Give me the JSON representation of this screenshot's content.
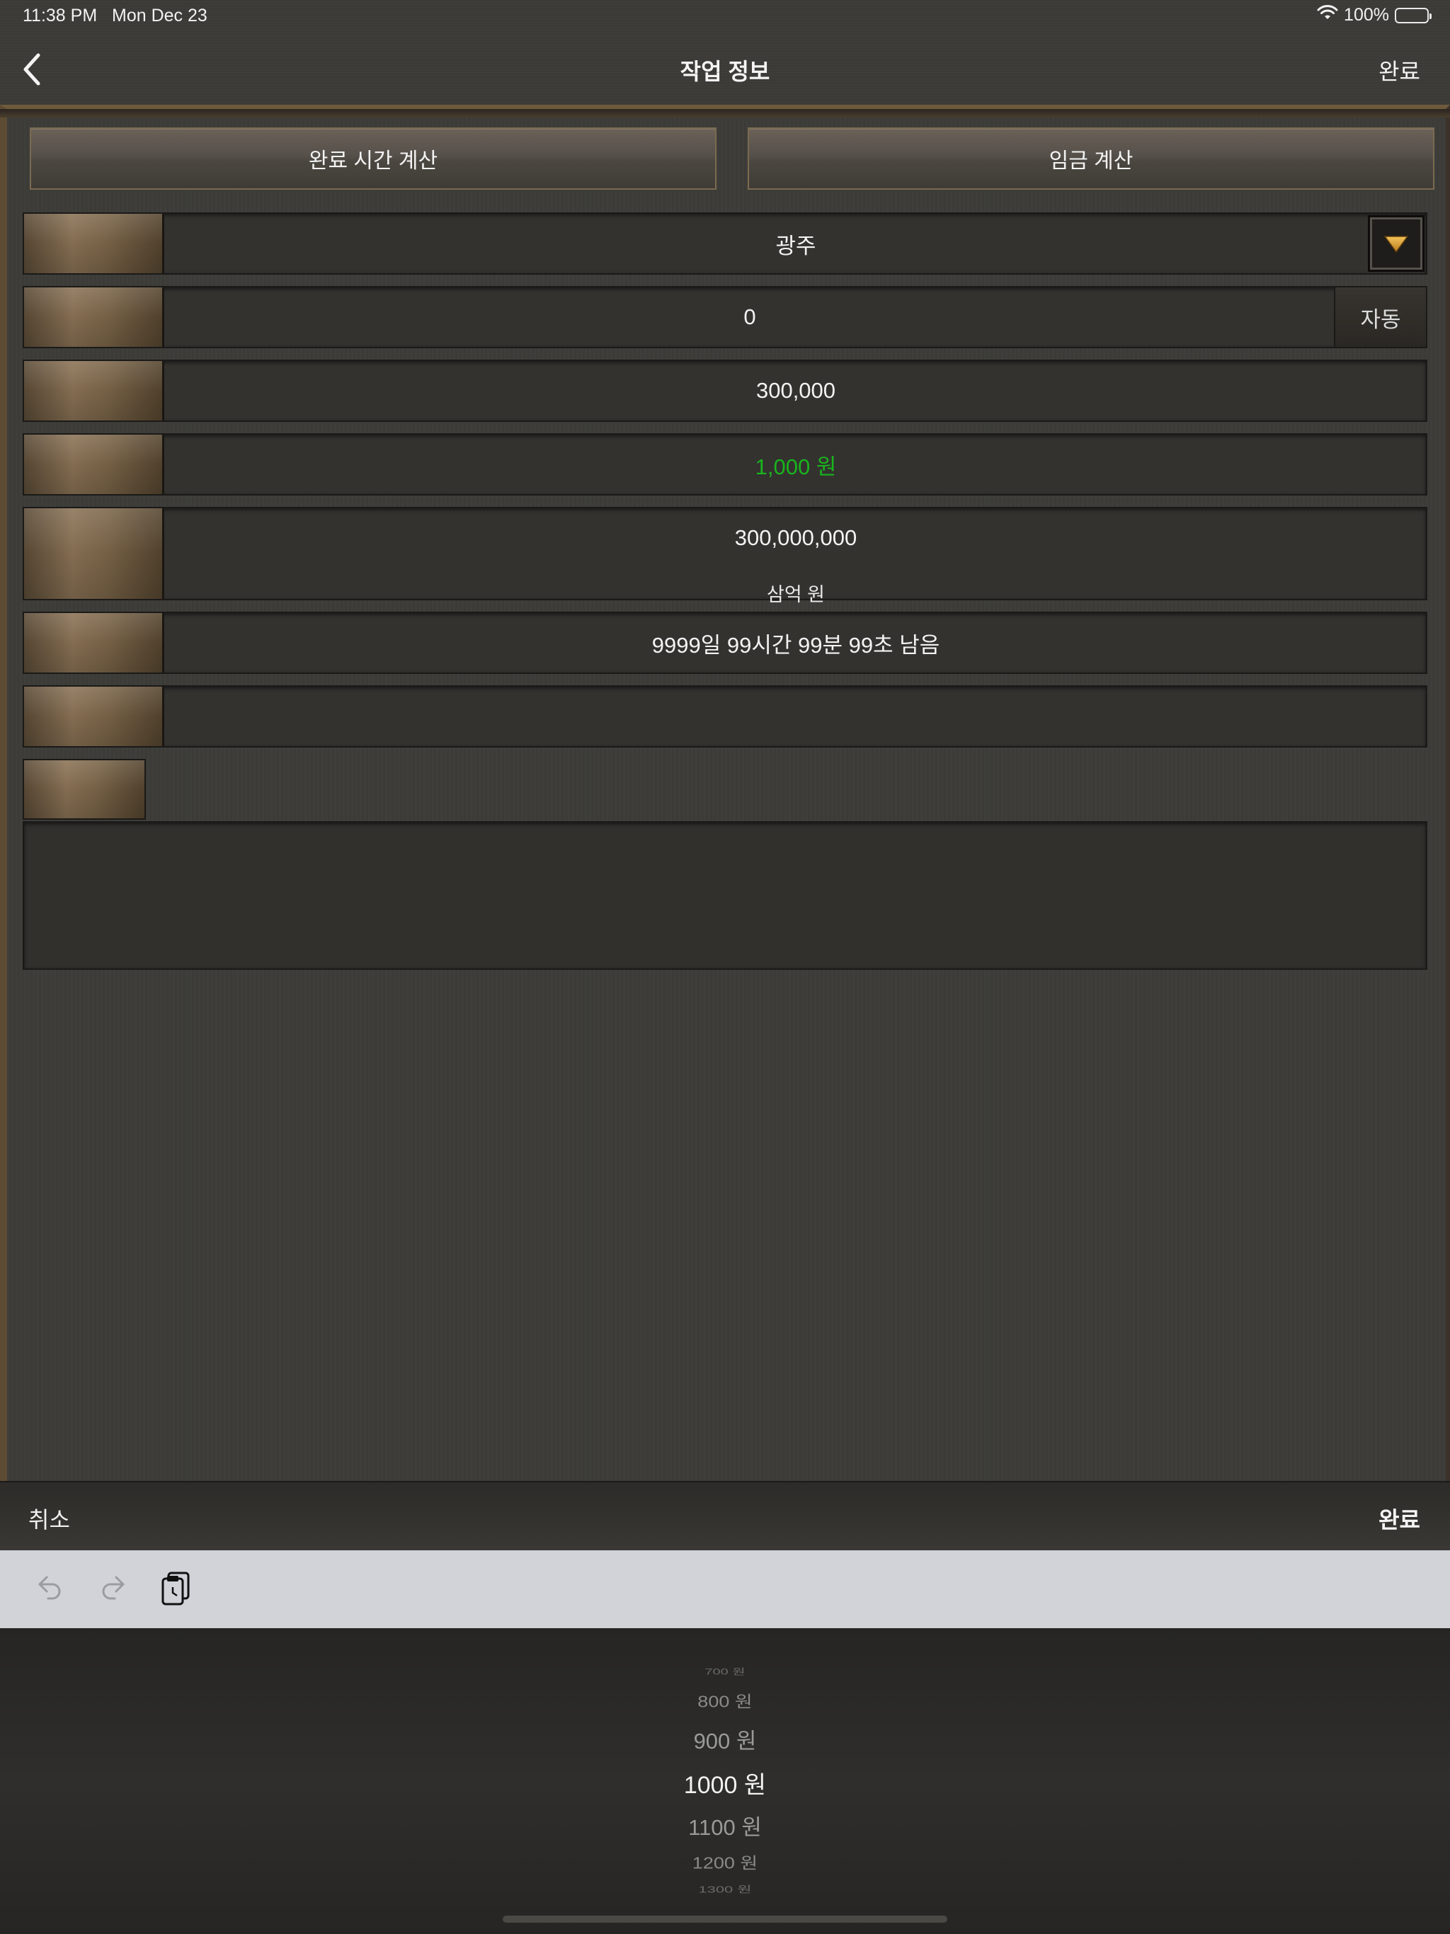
{
  "status_bar": {
    "time": "11:38 PM",
    "date": "Mon Dec 23",
    "battery_pct": "100%"
  },
  "nav": {
    "title": "작업 정보",
    "done_label": "완료"
  },
  "tabs": [
    {
      "label": "완료 시간 계산"
    },
    {
      "label": "임금 계산"
    }
  ],
  "fields": {
    "region": "광주",
    "count": "0",
    "auto_label": "자동",
    "quantity": "300,000",
    "wage": "1,000 원",
    "total": "300,000,000",
    "total_korean": "삼억 원",
    "remaining": "9999일 99시간 99분 99초 남음",
    "memo": ""
  },
  "picker_bar": {
    "cancel_label": "취소",
    "done_label": "완료"
  },
  "picker": {
    "items": [
      "700 원",
      "800 원",
      "900 원",
      "1000 원",
      "1100 원",
      "1200 원",
      "1300 원"
    ],
    "selected": "1000 원"
  },
  "colors": {
    "wage_text": "#19b41d",
    "dropdown_arrow": "#e0a83a"
  }
}
